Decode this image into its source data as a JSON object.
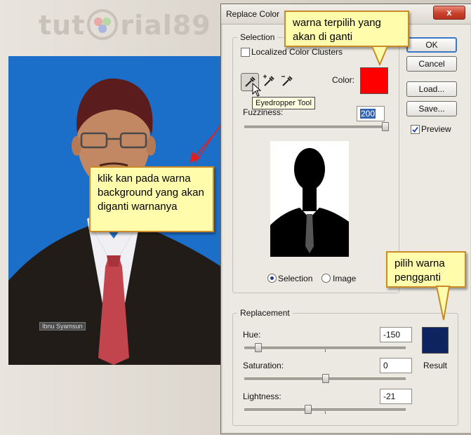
{
  "watermark": {
    "prefix": "tut",
    "suffix": "rial89"
  },
  "photo": {
    "name_tag": "Ibnu Syamsun"
  },
  "dialog": {
    "title": "Replace Color",
    "close_glyph": "x",
    "buttons": {
      "ok": "OK",
      "cancel": "Cancel",
      "load": "Load...",
      "save": "Save..."
    },
    "preview_label": "Preview",
    "preview_checked": true,
    "selection": {
      "legend": "Selection",
      "localized_label": "Localized Color Clusters",
      "localized_checked": false,
      "color_label": "Color:",
      "color_hex": "#ff0000",
      "fuzziness_label": "Fuzziness:",
      "fuzziness_value": "200",
      "fuzziness_fraction": 1.0,
      "radio_selection_label": "Selection",
      "radio_image_label": "Image",
      "selected_radio": "Selection"
    },
    "tooltip": "Eyedropper Tool",
    "replacement": {
      "legend": "Replacement",
      "hue_label": "Hue:",
      "hue_value": "-150",
      "saturation_label": "Saturation:",
      "saturation_value": "0",
      "lightness_label": "Lightness:",
      "lightness_value": "-21",
      "result_label": "Result",
      "result_hex": "#0d2460"
    }
  },
  "callouts": {
    "top": "warna terpilih yang akan di ganti",
    "left": "klik kan pada warna background yang akan diganti warnanya",
    "right": "pilih warna pengganti"
  },
  "colors": {
    "photo_bg": "#1c6fc9",
    "callout_bg": "#fffdab",
    "callout_border": "#c88b26",
    "arrow": "#e02020"
  }
}
